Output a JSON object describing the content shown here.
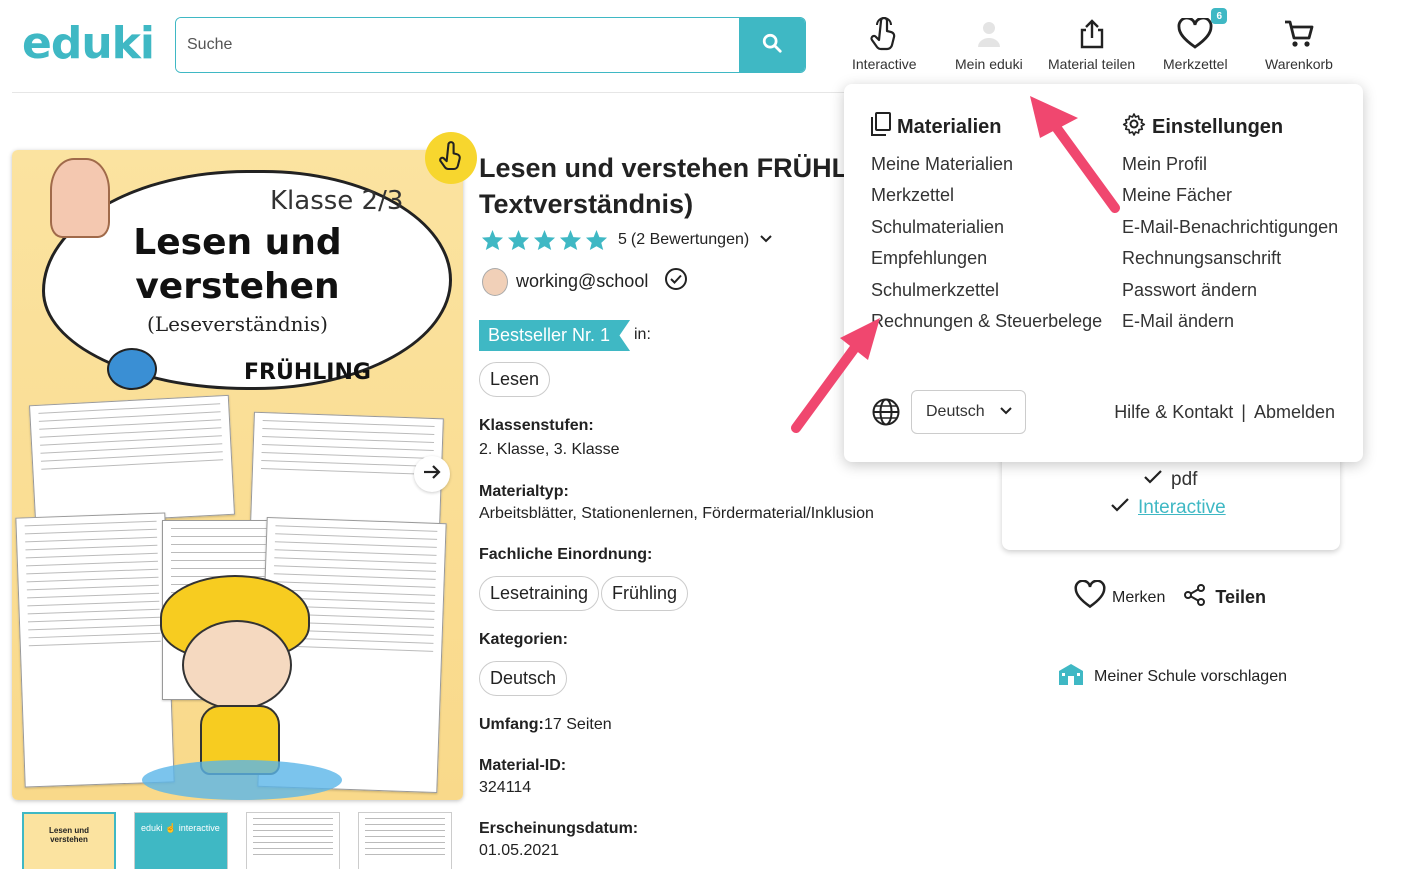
{
  "header": {
    "logo": "eduki",
    "search_placeholder": "Suche",
    "nav": [
      {
        "label": "Interactive",
        "icon": "hand-pointer-icon"
      },
      {
        "label": "Mein eduki",
        "icon": "user-icon"
      },
      {
        "label": "Material teilen",
        "icon": "share-upload-icon"
      },
      {
        "label": "Merkzettel",
        "icon": "heart-icon",
        "badge": "6"
      },
      {
        "label": "Warenkorb",
        "icon": "cart-icon"
      }
    ]
  },
  "cover": {
    "klasse": "Klasse 2/3",
    "title_line1": "Lesen und",
    "title_line2": "verstehen",
    "subtitle": "(Leseverständnis)",
    "season": "FRÜHLING",
    "thumb_teal_text": "eduki ☝ interactive"
  },
  "product": {
    "title_line1": "Lesen und verstehen FRÜHLIN",
    "title_line2": "Textverständnis)",
    "rating_value": "5",
    "rating_count": "(2 Bewertungen)",
    "stars": 5,
    "author": "working@school",
    "bestseller": "Bestseller Nr. 1",
    "bestseller_in": "in:",
    "bestseller_chip": "Lesen",
    "klassenstufen_label": "Klassenstufen:",
    "klassenstufen_value": "2. Klasse, 3. Klasse",
    "materialtyp_label": "Materialtyp:",
    "materialtyp_value": "Arbeitsblätter, Stationenlernen, Fördermaterial/Inklusion",
    "fachliche_label": "Fachliche Einordnung:",
    "fachliche_chips": [
      "Lesetraining",
      "Frühling"
    ],
    "kategorien_label": "Kategorien:",
    "kategorien_chip": "Deutsch",
    "umfang_label": "Umfang:",
    "umfang_value": "17 Seiten",
    "material_id_label": "Material-ID:",
    "material_id_value": "324114",
    "datum_label": "Erscheinungsdatum:",
    "datum_value": "01.05.2021"
  },
  "buybox": {
    "format_pdf": "pdf",
    "format_interactive": "Interactive",
    "merken": "Merken",
    "teilen": "Teilen",
    "suggest": "Meiner Schule vorschlagen"
  },
  "dropdown": {
    "materialien_title": "Materialien",
    "materialien_items": [
      "Meine Materialien",
      "Merkzettel",
      "Schulmaterialien",
      "Empfehlungen",
      "Schulmerkzettel",
      "Rechnungen & Steuerbelege"
    ],
    "einstellungen_title": "Einstellungen",
    "einstellungen_items": [
      "Mein Profil",
      "Meine Fächer",
      "E-Mail-Benachrichtigungen",
      "Rechnungsanschrift",
      "Passwort ändern",
      "E-Mail ändern"
    ],
    "language": "Deutsch",
    "help": "Hilfe & Kontakt",
    "separator": "|",
    "logout": "Abmelden"
  },
  "colors": {
    "accent": "#3fb8c4",
    "star": "#3fb8c4",
    "arrow": "#f0476f",
    "badge_yellow": "#f7d62e"
  }
}
